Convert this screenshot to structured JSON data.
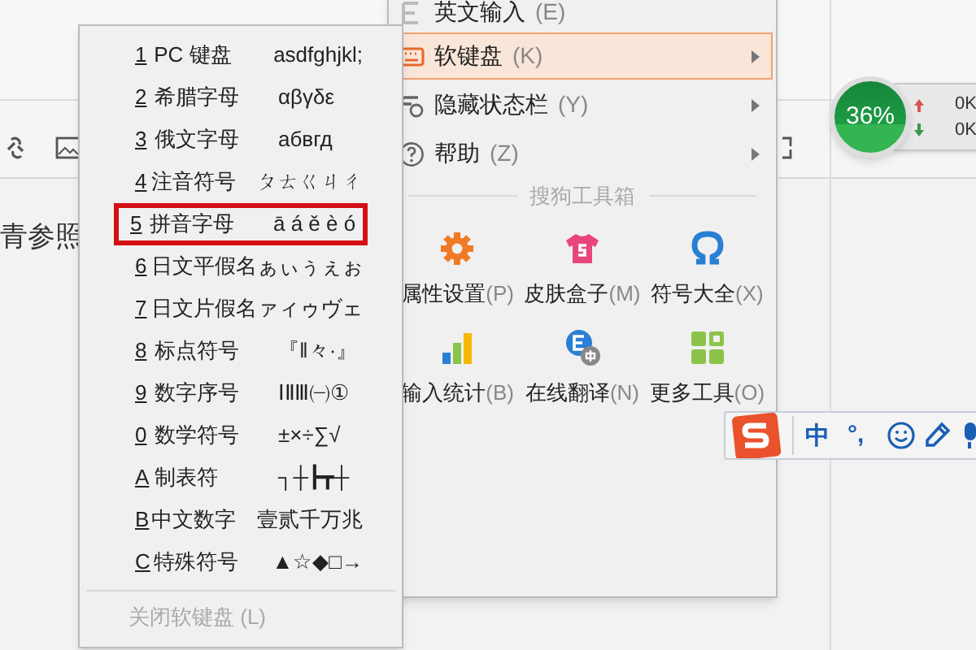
{
  "editor": {
    "body_text": "青参照"
  },
  "ime_menu": {
    "items": [
      {
        "label": "英文输入",
        "key": "(E)",
        "selected": false,
        "submenu": false
      },
      {
        "label": "软键盘",
        "key": "(K)",
        "selected": true,
        "submenu": true
      },
      {
        "label": "隐藏状态栏",
        "key": "(Y)",
        "selected": false,
        "submenu": true
      },
      {
        "label": "帮助",
        "key": "(Z)",
        "selected": false,
        "submenu": true
      }
    ],
    "toolbox_title": "搜狗工具箱",
    "tools": [
      {
        "label": "属性设置",
        "key": "(P)"
      },
      {
        "label": "皮肤盒子",
        "key": "(M)"
      },
      {
        "label": "符号大全",
        "key": "(X)"
      },
      {
        "label": "输入统计",
        "key": "(B)"
      },
      {
        "label": "在线翻译",
        "key": "(N)"
      },
      {
        "label": "更多工具",
        "key": "(O)"
      }
    ]
  },
  "soft_keyboard_menu": {
    "items": [
      {
        "key": "1",
        "label": "PC 键盘",
        "sample": "asdfghjkl;",
        "selected": false
      },
      {
        "key": "2",
        "label": "希腊字母",
        "sample": "αβγδε",
        "selected": false
      },
      {
        "key": "3",
        "label": "俄文字母",
        "sample": "абвгд",
        "selected": false
      },
      {
        "key": "4",
        "label": "注音符号",
        "sample": "ㄆㄊㄍㄐㄔ",
        "selected": false
      },
      {
        "key": "5",
        "label": "拼音字母",
        "sample": "ā á ě è ó",
        "selected": true
      },
      {
        "key": "6",
        "label": "日文平假名",
        "sample": "ぁぃぅぇぉ",
        "selected": false
      },
      {
        "key": "7",
        "label": "日文片假名",
        "sample": "ァィゥヴェ",
        "selected": false
      },
      {
        "key": "8",
        "label": "标点符号",
        "sample": "『‖々·』",
        "selected": false
      },
      {
        "key": "9",
        "label": "数字序号",
        "sample": "ⅠⅡⅢ㈠①",
        "selected": false
      },
      {
        "key": "0",
        "label": "数学符号",
        "sample": "±×÷∑√",
        "selected": false
      },
      {
        "key": "A",
        "label": "制表符",
        "sample": "┐┼┣┳┼",
        "selected": false
      },
      {
        "key": "B",
        "label": "中文数字",
        "sample": "壹贰千万兆",
        "selected": false
      },
      {
        "key": "C",
        "label": "特殊符号",
        "sample": "▲☆◆□→",
        "selected": false
      }
    ],
    "close": {
      "label": "关闭软键盘",
      "key": "(L)",
      "disabled": true
    }
  },
  "speed_widget": {
    "percent": "36%",
    "upload": "0K",
    "download": "0K"
  },
  "ime_status_bar": {
    "mode": "中",
    "punctuation": "°,"
  }
}
